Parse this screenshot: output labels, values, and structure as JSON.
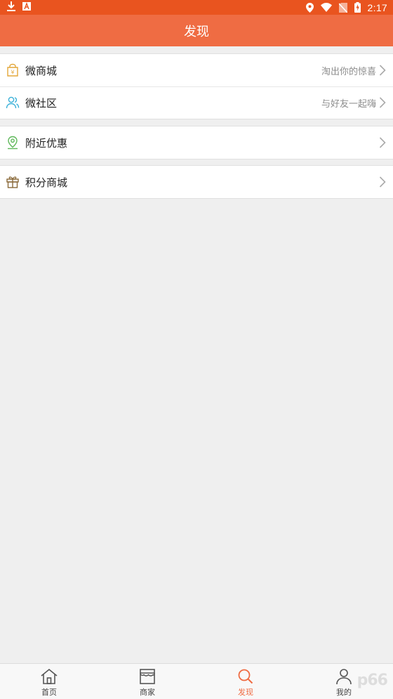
{
  "status_bar": {
    "time": "2:17",
    "icons": [
      "download-icon",
      "notification-a-icon",
      "location-icon",
      "wifi-icon",
      "no-sim-icon",
      "battery-charging-icon"
    ]
  },
  "header": {
    "title": "发现"
  },
  "groups": [
    {
      "items": [
        {
          "label": "微商城",
          "subtitle": "淘出你的惊喜",
          "icon": "shopping-bag-yen-icon",
          "icon_color": "#e3a73a"
        },
        {
          "label": "微社区",
          "subtitle": "与好友一起嗨",
          "icon": "users-icon",
          "icon_color": "#3ab0d8"
        }
      ]
    },
    {
      "items": [
        {
          "label": "附近优惠",
          "subtitle": "",
          "icon": "location-pin-icon",
          "icon_color": "#5fb85a"
        }
      ]
    },
    {
      "items": [
        {
          "label": "积分商城",
          "subtitle": "",
          "icon": "gift-icon",
          "icon_color": "#8a6a3a"
        }
      ]
    }
  ],
  "tab_bar": {
    "tabs": [
      {
        "label": "首页",
        "icon": "home-icon",
        "active": false
      },
      {
        "label": "商家",
        "icon": "store-icon",
        "active": false
      },
      {
        "label": "发现",
        "icon": "search-icon",
        "active": true
      },
      {
        "label": "我的",
        "icon": "user-icon",
        "active": false
      }
    ]
  },
  "colors": {
    "status_bar": "#e9541f",
    "header": "#ef6c43",
    "accent": "#ef6c43",
    "background": "#efefef"
  },
  "watermark": {
    "text": "p66"
  }
}
